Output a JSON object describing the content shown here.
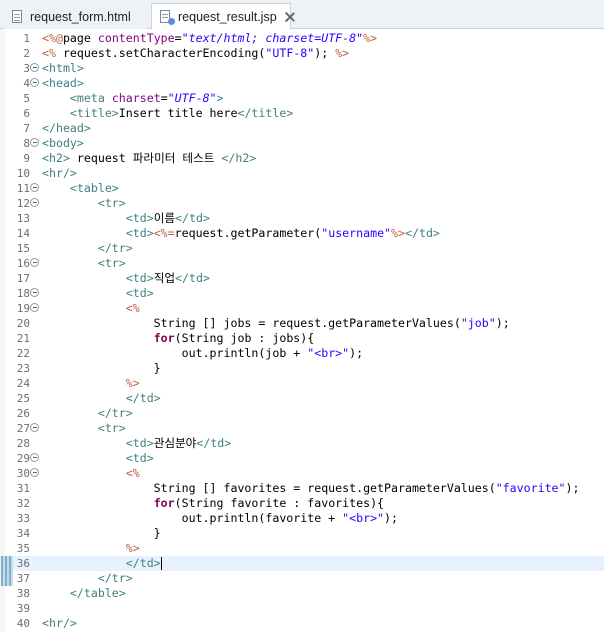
{
  "tabs": [
    {
      "label": "request_form.html",
      "active": false
    },
    {
      "label": "request_result.jsp",
      "active": true
    }
  ],
  "colors": {
    "tag": "#3f7f7f",
    "attr": "#7f007f",
    "attr_value": "#2a00ff",
    "jsp_delim": "#bf5f3f",
    "keyword": "#7f0055",
    "string": "#2a00ff",
    "current_line": "#e8f2fe"
  },
  "editor": {
    "lines": [
      {
        "n": "1",
        "fold": false,
        "tokens": [
          [
            "js",
            "<%@"
          ],
          [
            "",
            "page "
          ],
          [
            "a",
            "contentType"
          ],
          [
            "",
            "="
          ],
          [
            "s",
            "\"text/html; charset=UTF-8\""
          ],
          [
            "js",
            "%>"
          ]
        ]
      },
      {
        "n": "2",
        "fold": false,
        "tokens": [
          [
            "js",
            "<%"
          ],
          [
            "",
            " request.setCharacterEncoding("
          ],
          [
            "str",
            "\"UTF-8\""
          ],
          [
            "",
            "); "
          ],
          [
            "js",
            "%>"
          ]
        ]
      },
      {
        "n": "3",
        "fold": true,
        "tokens": [
          [
            "t",
            "<html>"
          ]
        ]
      },
      {
        "n": "4",
        "fold": true,
        "tokens": [
          [
            "t",
            "<head>"
          ]
        ]
      },
      {
        "n": "5",
        "fold": false,
        "tokens": [
          [
            "",
            "    "
          ],
          [
            "t",
            "<meta "
          ],
          [
            "a",
            "charset"
          ],
          [
            "",
            "="
          ],
          [
            "s",
            "\"UTF-8\""
          ],
          [
            "t",
            ">"
          ]
        ]
      },
      {
        "n": "6",
        "fold": false,
        "tokens": [
          [
            "",
            "    "
          ],
          [
            "t",
            "<title>"
          ],
          [
            "",
            "Insert title here"
          ],
          [
            "t",
            "</title>"
          ]
        ]
      },
      {
        "n": "7",
        "fold": false,
        "tokens": [
          [
            "t",
            "</head>"
          ]
        ]
      },
      {
        "n": "8",
        "fold": true,
        "tokens": [
          [
            "t",
            "<body>"
          ]
        ]
      },
      {
        "n": "9",
        "fold": false,
        "tokens": [
          [
            "t",
            "<h2>"
          ],
          [
            "",
            " request 파라미터 테스트 "
          ],
          [
            "t",
            "</h2>"
          ]
        ]
      },
      {
        "n": "10",
        "fold": false,
        "tokens": [
          [
            "t",
            "<hr/>"
          ]
        ]
      },
      {
        "n": "11",
        "fold": true,
        "tokens": [
          [
            "",
            "    "
          ],
          [
            "t",
            "<table>"
          ]
        ]
      },
      {
        "n": "12",
        "fold": true,
        "tokens": [
          [
            "",
            "        "
          ],
          [
            "t",
            "<tr>"
          ]
        ]
      },
      {
        "n": "13",
        "fold": false,
        "tokens": [
          [
            "",
            "            "
          ],
          [
            "t",
            "<td>"
          ],
          [
            "",
            "이름"
          ],
          [
            "t",
            "</td>"
          ]
        ]
      },
      {
        "n": "14",
        "fold": false,
        "tokens": [
          [
            "",
            "            "
          ],
          [
            "t",
            "<td>"
          ],
          [
            "js",
            "<%="
          ],
          [
            "",
            "request.getParameter("
          ],
          [
            "str",
            "\"username\""
          ],
          [
            ")"
          ],
          [
            "js",
            "%>"
          ],
          [
            "t",
            "</td>"
          ]
        ]
      },
      {
        "n": "15",
        "fold": false,
        "tokens": [
          [
            "",
            "        "
          ],
          [
            "t",
            "</tr>"
          ]
        ]
      },
      {
        "n": "16",
        "fold": true,
        "tokens": [
          [
            "",
            "        "
          ],
          [
            "t",
            "<tr>"
          ]
        ]
      },
      {
        "n": "17",
        "fold": false,
        "tokens": [
          [
            "",
            "            "
          ],
          [
            "t",
            "<td>"
          ],
          [
            "",
            "직업"
          ],
          [
            "t",
            "</td>"
          ]
        ]
      },
      {
        "n": "18",
        "fold": true,
        "tokens": [
          [
            "",
            "            "
          ],
          [
            "t",
            "<td>"
          ]
        ]
      },
      {
        "n": "19",
        "fold": true,
        "tokens": [
          [
            "",
            "            "
          ],
          [
            "js",
            "<%"
          ]
        ]
      },
      {
        "n": "20",
        "fold": false,
        "tokens": [
          [
            "",
            "                String [] jobs = request.getParameterValues("
          ],
          [
            "str",
            "\"job\""
          ],
          [
            "",
            ");"
          ]
        ]
      },
      {
        "n": "21",
        "fold": false,
        "tokens": [
          [
            "",
            "                "
          ],
          [
            "kw",
            "for"
          ],
          [
            "",
            "(String job : jobs){"
          ]
        ]
      },
      {
        "n": "22",
        "fold": false,
        "tokens": [
          [
            "",
            "                    out.println(job + "
          ],
          [
            "str",
            "\"<br>\""
          ],
          [
            "",
            ");"
          ]
        ]
      },
      {
        "n": "23",
        "fold": false,
        "tokens": [
          [
            "",
            "                }"
          ]
        ]
      },
      {
        "n": "24",
        "fold": false,
        "tokens": [
          [
            "",
            "            "
          ],
          [
            "js",
            "%>"
          ]
        ]
      },
      {
        "n": "25",
        "fold": false,
        "tokens": [
          [
            "",
            "            "
          ],
          [
            "t",
            "</td>"
          ]
        ]
      },
      {
        "n": "26",
        "fold": false,
        "tokens": [
          [
            "",
            "        "
          ],
          [
            "t",
            "</tr>"
          ]
        ]
      },
      {
        "n": "27",
        "fold": true,
        "tokens": [
          [
            "",
            "        "
          ],
          [
            "t",
            "<tr>"
          ]
        ]
      },
      {
        "n": "28",
        "fold": false,
        "tokens": [
          [
            "",
            "            "
          ],
          [
            "t",
            "<td>"
          ],
          [
            "",
            "관심분야"
          ],
          [
            "t",
            "</td>"
          ]
        ]
      },
      {
        "n": "29",
        "fold": true,
        "tokens": [
          [
            "",
            "            "
          ],
          [
            "t",
            "<td>"
          ]
        ]
      },
      {
        "n": "30",
        "fold": true,
        "tokens": [
          [
            "",
            "            "
          ],
          [
            "js",
            "<%"
          ]
        ]
      },
      {
        "n": "31",
        "fold": false,
        "tokens": [
          [
            "",
            "                String [] favorites = request.getParameterValues("
          ],
          [
            "str",
            "\"favorite\""
          ],
          [
            "",
            ");"
          ]
        ]
      },
      {
        "n": "32",
        "fold": false,
        "tokens": [
          [
            "",
            "                "
          ],
          [
            "kw",
            "for"
          ],
          [
            "",
            "(String favorite : favorites){"
          ]
        ]
      },
      {
        "n": "33",
        "fold": false,
        "tokens": [
          [
            "",
            "                    out.println(favorite + "
          ],
          [
            "str",
            "\"<br>\""
          ],
          [
            "",
            ");"
          ]
        ]
      },
      {
        "n": "34",
        "fold": false,
        "tokens": [
          [
            "",
            "                }"
          ]
        ]
      },
      {
        "n": "35",
        "fold": false,
        "tokens": [
          [
            "",
            "            "
          ],
          [
            "js",
            "%>"
          ]
        ]
      },
      {
        "n": "36",
        "fold": false,
        "current": true,
        "marker": true,
        "tokens": [
          [
            "",
            "            "
          ],
          [
            "t",
            "</td>"
          ]
        ]
      },
      {
        "n": "37",
        "fold": false,
        "marker": true,
        "tokens": [
          [
            "",
            "        "
          ],
          [
            "t",
            "</tr>"
          ]
        ]
      },
      {
        "n": "38",
        "fold": false,
        "tokens": [
          [
            "",
            "    "
          ],
          [
            "t",
            "</table>"
          ]
        ]
      },
      {
        "n": "39",
        "fold": false,
        "tokens": []
      },
      {
        "n": "40",
        "fold": false,
        "tokens": [
          [
            "t",
            "<hr/>"
          ]
        ]
      }
    ]
  }
}
